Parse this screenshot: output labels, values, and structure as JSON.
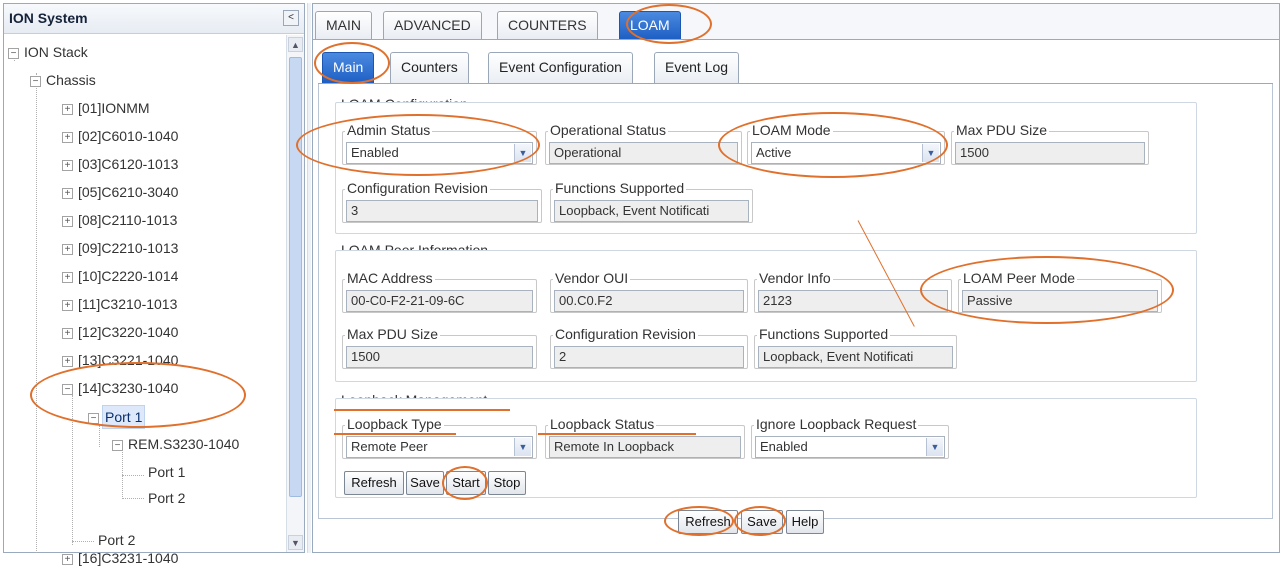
{
  "tree": {
    "title": "ION System",
    "collapse_icon": "collapse-left-icon",
    "nodes": [
      {
        "label": "ION Stack"
      },
      {
        "label": "Chassis"
      },
      {
        "label": "[01]IONMM"
      },
      {
        "label": "[02]C6010-1040"
      },
      {
        "label": "[03]C6120-1013"
      },
      {
        "label": "[05]C6210-3040"
      },
      {
        "label": "[08]C2110-1013"
      },
      {
        "label": "[09]C2210-1013"
      },
      {
        "label": "[10]C2220-1014"
      },
      {
        "label": "[11]C3210-1013"
      },
      {
        "label": "[12]C3220-1040"
      },
      {
        "label": "[13]C3221-1040"
      },
      {
        "label": "[14]C3230-1040"
      },
      {
        "label": "Port 1"
      },
      {
        "label": "REM.S3230-1040"
      },
      {
        "label": "Port 1"
      },
      {
        "label": "Port 2"
      },
      {
        "label": "Port 2"
      },
      {
        "label": "[16]C3231-1040"
      }
    ]
  },
  "top_tabs": [
    "MAIN",
    "ADVANCED",
    "COUNTERS",
    "LOAM"
  ],
  "sub_tabs": [
    "Main",
    "Counters",
    "Event Configuration",
    "Event Log"
  ],
  "loam_config": {
    "title": "LOAM Configuration",
    "admin_status": {
      "label": "Admin Status",
      "value": "Enabled"
    },
    "operational_status": {
      "label": "Operational Status",
      "value": "Operational"
    },
    "loam_mode": {
      "label": "LOAM Mode",
      "value": "Active"
    },
    "max_pdu": {
      "label": "Max PDU Size",
      "value": "1500"
    },
    "config_revision": {
      "label": "Configuration Revision",
      "value": "3"
    },
    "functions_supported": {
      "label": "Functions Supported",
      "value": "Loopback, Event Notificati"
    }
  },
  "peer_info": {
    "title": "LOAM Peer Information",
    "mac_address": {
      "label": "MAC Address",
      "value": "00-C0-F2-21-09-6C"
    },
    "vendor_oui": {
      "label": "Vendor OUI",
      "value": "00.C0.F2"
    },
    "vendor_info": {
      "label": "Vendor Info",
      "value": "2123"
    },
    "peer_mode": {
      "label": "LOAM Peer Mode",
      "value": "Passive"
    },
    "max_pdu": {
      "label": "Max PDU Size",
      "value": "1500"
    },
    "config_revision": {
      "label": "Configuration Revision",
      "value": "2"
    },
    "functions_supported": {
      "label": "Functions Supported",
      "value": "Loopback, Event Notificati"
    }
  },
  "loopback": {
    "title": "Loopback Management",
    "type": {
      "label": "Loopback Type",
      "value": "Remote Peer"
    },
    "status": {
      "label": "Loopback Status",
      "value": "Remote In Loopback"
    },
    "ignore_request": {
      "label": "Ignore Loopback Request",
      "value": "Enabled"
    },
    "buttons": [
      "Refresh",
      "Save",
      "Start",
      "Stop"
    ]
  },
  "footer_buttons": [
    "Refresh",
    "Save",
    "Help"
  ],
  "colors": {
    "annotation": "#e0702b",
    "active_tab": "#1e5fc4"
  }
}
